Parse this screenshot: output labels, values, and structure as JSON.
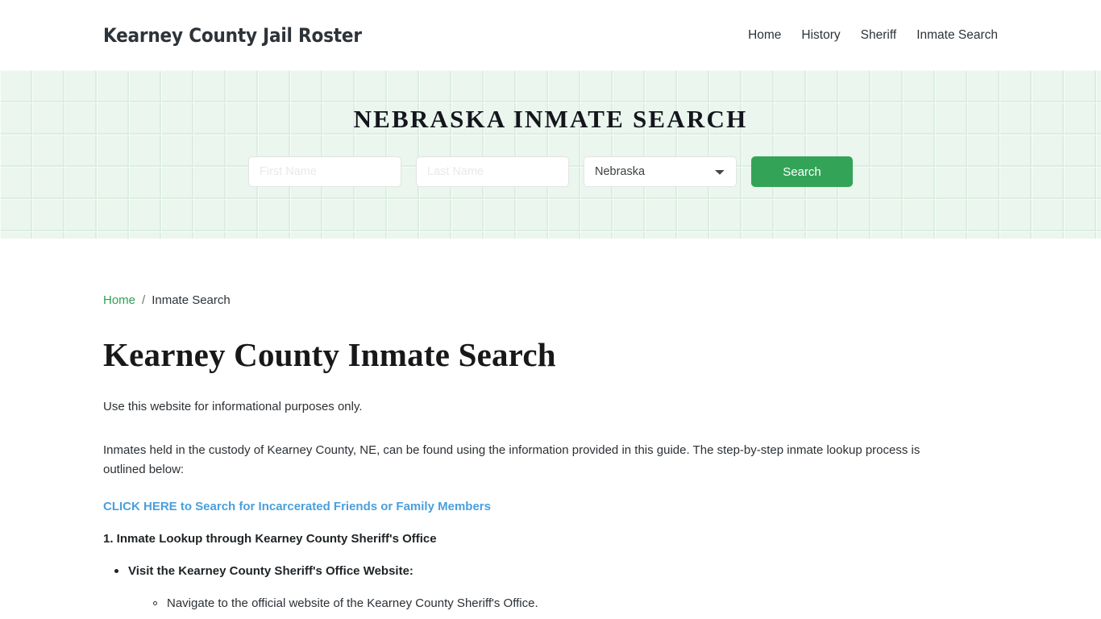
{
  "header": {
    "site_title": "Kearney County Jail Roster",
    "nav": [
      {
        "label": "Home"
      },
      {
        "label": "History"
      },
      {
        "label": "Sheriff"
      },
      {
        "label": "Inmate Search"
      }
    ]
  },
  "hero": {
    "title": "NEBRASKA INMATE SEARCH",
    "form": {
      "first_name_placeholder": "First Name",
      "first_name_value": "",
      "last_name_placeholder": "Last Name",
      "last_name_value": "",
      "state_selected": "Nebraska",
      "state_options": [
        "Nebraska"
      ],
      "search_label": "Search",
      "search_button_color": "#33a457"
    }
  },
  "breadcrumb": {
    "home_label": "Home",
    "separator": "/",
    "current_label": "Inmate Search",
    "link_color": "#2f9e54"
  },
  "main": {
    "page_title": "Kearney County Inmate Search",
    "paragraph_1": "Use this website for informational purposes only.",
    "paragraph_2": "Inmates held in the custody of Kearney County, NE, can be found using the information provided in this guide. The step-by-step inmate lookup process is outlined below:",
    "cta_link": "CLICK HERE to Search for Incarcerated Friends or Family Members",
    "cta_color": "#4a9fdc",
    "step_heading": "1. Inmate Lookup through Kearney County Sheriff's Office",
    "bullet_1": "Visit the Kearney County Sheriff's Office Website:",
    "sub_bullet_1": "Navigate to the official website of the Kearney County Sheriff's Office."
  }
}
